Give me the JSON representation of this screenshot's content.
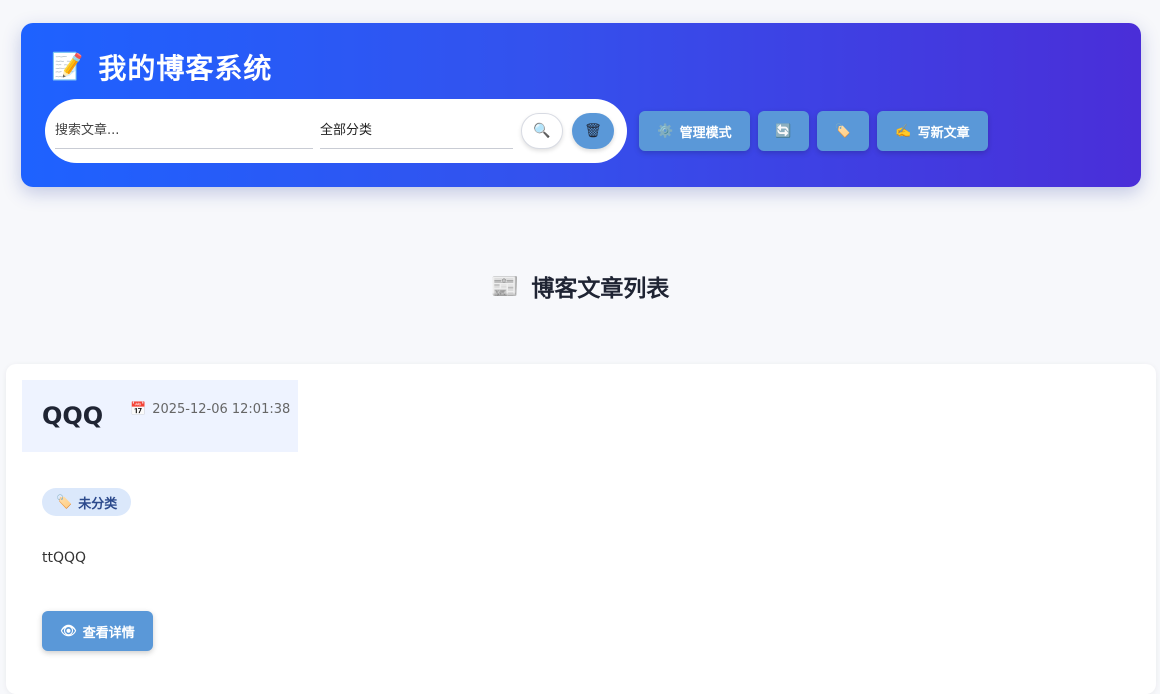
{
  "header": {
    "app_title": "我的博客系统",
    "app_icon": "📝",
    "search": {
      "placeholder": "搜索文章..."
    },
    "category_filter": {
      "selected": "全部分类"
    },
    "search_icon": "🔍",
    "clear_icon": "🗑",
    "buttons": [
      {
        "icon": "⚙️",
        "label": "管理模式"
      },
      {
        "icon": "🔄",
        "label": ""
      },
      {
        "icon": "🏷️",
        "label": ""
      },
      {
        "icon": "✍️",
        "label": "写新文章"
      }
    ]
  },
  "section": {
    "icon": "📰",
    "title": "博客文章列表"
  },
  "posts": [
    {
      "title": "QQQ",
      "date_icon": "📅",
      "date": "2025-12-06 12:01:38",
      "category_icon": "🏷️",
      "category": "未分类",
      "excerpt": "ttQQQ",
      "detail_icon": "👁",
      "detail_label": "查看详情"
    }
  ],
  "colors": {
    "header_gradient_start": "#1e62ff",
    "header_gradient_end": "#4a2ed8",
    "button_blue": "#5a98d8",
    "tag_bg": "#dbe8fb",
    "card_head_bg": "#eef3ff"
  }
}
